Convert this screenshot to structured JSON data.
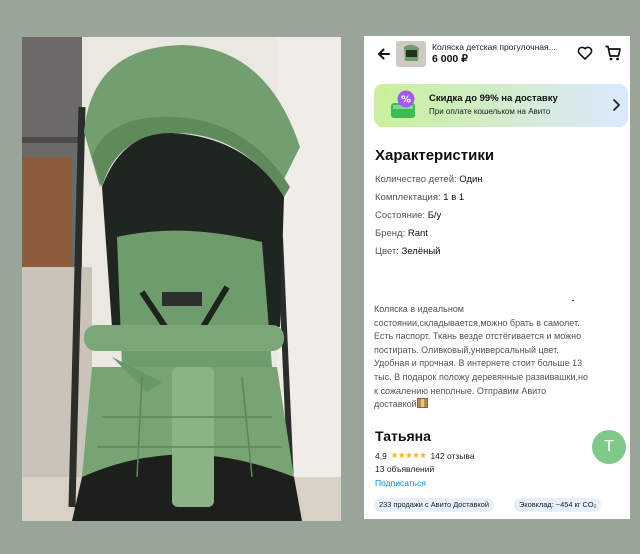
{
  "listing": {
    "title": "Коляска детская прогулочная...",
    "price": "6 000 ₽"
  },
  "promo": {
    "title": "Скидка до 99% на доставку",
    "subtitle": "При оплате кошельком на Авито",
    "icon_text": "%"
  },
  "specs": {
    "heading": "Характеристики",
    "items": [
      {
        "key": "Количество детей:",
        "value": "Один"
      },
      {
        "key": "Комплектация:",
        "value": "1 в 1"
      },
      {
        "key": "Состояние:",
        "value": "Б/у"
      },
      {
        "key": "Бренд:",
        "value": "Rant"
      },
      {
        "key": "Цвет:",
        "value": "Зелёный"
      }
    ]
  },
  "description": {
    "lines": [
      "Коляска в идеальном",
      "состоянии,складывается,можно брать в самолет.",
      "Есть паспорт. Ткань везде отстёгивается и можно",
      "постирать. Оливковый,универсальный цвет.",
      "Удобная и прочная. В интернете стоит больше 13",
      "тыс. В подарок положу деревянные развивашки,но",
      "к сожалению неполные. Отправим Авито",
      "доставкой"
    ]
  },
  "seller": {
    "name": "Татьяна",
    "rating": "4,9",
    "stars": "★★★★★",
    "reviews": "142 отзыва",
    "ads": "13 объявлений",
    "subscribe": "Подписаться",
    "avatar_letter": "Т",
    "avatar_color": "#7ec98a"
  },
  "chips": [
    "233 продажи с Авито Доставкой",
    "Эковклад: ~454 кг CO₂"
  ],
  "icons": {
    "back": "arrow-left-icon",
    "favorite": "heart-icon",
    "cart": "cart-icon",
    "promo": "wallet-percent-icon",
    "chevron": "chevron-right-icon"
  },
  "colors": {
    "background": "#98a598",
    "stroller_green": "#6f9c6d",
    "link": "#0a8cd6",
    "star": "#ffb021"
  }
}
